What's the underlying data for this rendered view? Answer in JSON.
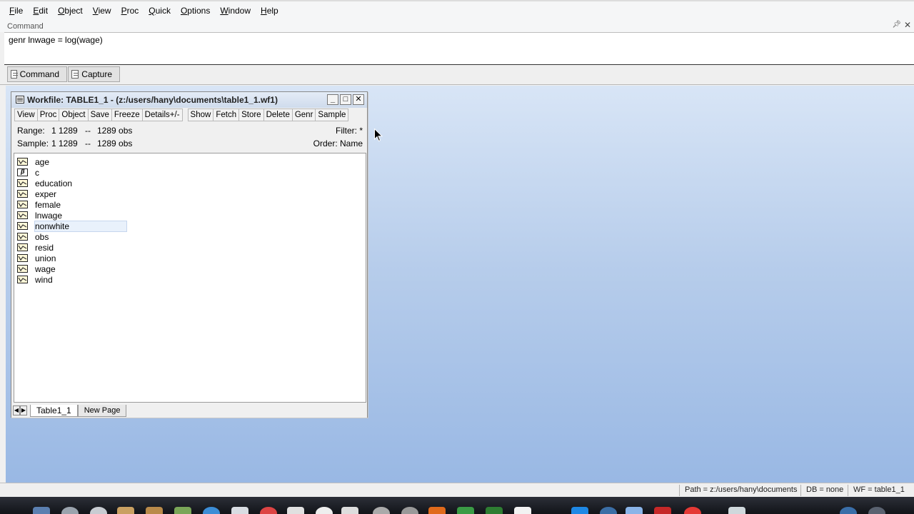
{
  "menu": {
    "items": [
      {
        "ul": "F",
        "rest": "ile"
      },
      {
        "ul": "E",
        "rest": "dit"
      },
      {
        "ul": "O",
        "rest": "bject"
      },
      {
        "ul": "V",
        "rest": "iew"
      },
      {
        "ul": "P",
        "rest": "roc"
      },
      {
        "ul": "Q",
        "rest": "uick"
      },
      {
        "ul": "O",
        "rest": "ptions"
      },
      {
        "ul": "W",
        "rest": "indow"
      },
      {
        "ul": "H",
        "rest": "elp"
      }
    ]
  },
  "command": {
    "header": "Command",
    "pin_icon": "pin-icon",
    "close_icon": "close-icon",
    "text": "genr lnwage = log(wage)"
  },
  "pane_tabs": [
    "Command",
    "Capture"
  ],
  "workfile": {
    "title": "Workfile: TABLE1_1 - (z:/users/hany\\documents\\table1_1.wf1)",
    "toolbar": [
      "View",
      "Proc",
      "Object",
      "Save",
      "Freeze",
      "Details+/-",
      "Show",
      "Fetch",
      "Store",
      "Delete",
      "Genr",
      "Sample"
    ],
    "range_label": "Range:",
    "range_value": "1 1289",
    "range_sep": "--",
    "range_obs": "1289 obs",
    "sample_label": "Sample:",
    "sample_value": "1 1289",
    "sample_sep": "--",
    "sample_obs": "1289 obs",
    "filter": "Filter: *",
    "order": "Order: Name",
    "objects": [
      {
        "name": "age",
        "type": "series"
      },
      {
        "name": "c",
        "type": "coef"
      },
      {
        "name": "education",
        "type": "series"
      },
      {
        "name": "exper",
        "type": "series"
      },
      {
        "name": "female",
        "type": "series"
      },
      {
        "name": "lnwage",
        "type": "series"
      },
      {
        "name": "nonwhite",
        "type": "series",
        "selected": true
      },
      {
        "name": "obs",
        "type": "series"
      },
      {
        "name": "resid",
        "type": "series"
      },
      {
        "name": "union",
        "type": "series"
      },
      {
        "name": "wage",
        "type": "series"
      },
      {
        "name": "wind",
        "type": "series"
      }
    ],
    "page_tabs": [
      "Table1_1",
      "New Page"
    ]
  },
  "status": {
    "path": "Path = z:/users/hany\\documents",
    "db": "DB = none",
    "wf": "WF = table1_1"
  }
}
